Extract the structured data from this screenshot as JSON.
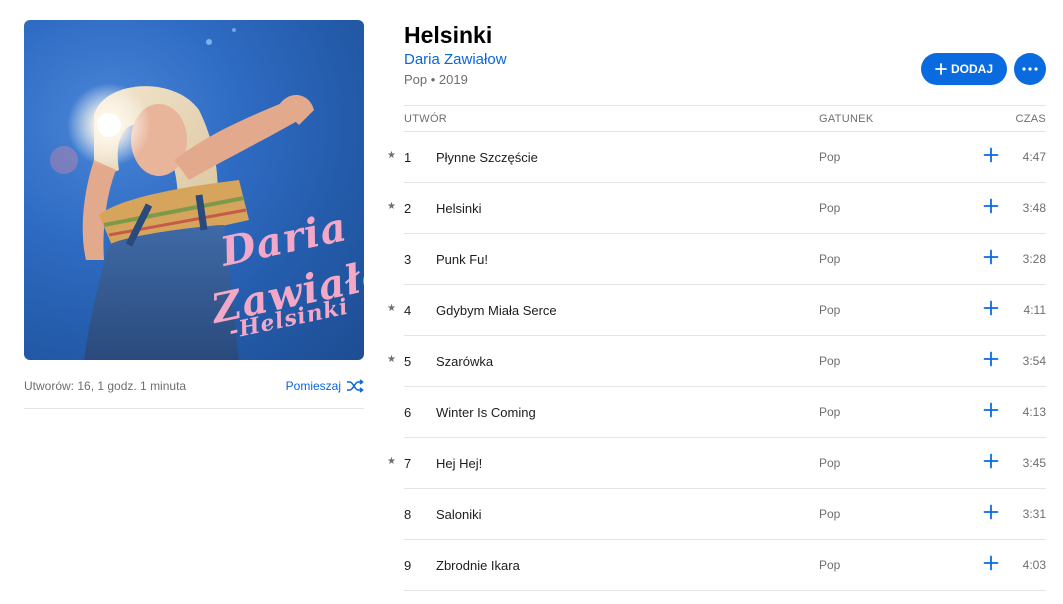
{
  "album": {
    "title": "Helsinki",
    "artist": "Daria Zawiałow",
    "genre_year": "Pop • 2019",
    "artwork_text": [
      "Daria",
      "Zawiałow",
      "-Helsinki"
    ]
  },
  "summary": {
    "track_count": "Utworów: 16, 1 godz. 1 minuta",
    "shuffle_label": "Pomieszaj"
  },
  "actions": {
    "add_label": "DODAJ",
    "add_icon": "plus-icon",
    "more_icon": "ellipsis-icon"
  },
  "columns": {
    "track": "UTWÓR",
    "genre": "GATUNEK",
    "time": "CZAS"
  },
  "tracks": [
    {
      "star": "★",
      "num": "1",
      "name": "Płynne Szczęście",
      "genre": "Pop",
      "time": "4:47"
    },
    {
      "star": "★",
      "num": "2",
      "name": "Helsinki",
      "genre": "Pop",
      "time": "3:48"
    },
    {
      "star": "",
      "num": "3",
      "name": "Punk Fu!",
      "genre": "Pop",
      "time": "3:28"
    },
    {
      "star": "★",
      "num": "4",
      "name": "Gdybym Miała Serce",
      "genre": "Pop",
      "time": "4:11"
    },
    {
      "star": "★",
      "num": "5",
      "name": "Szarówka",
      "genre": "Pop",
      "time": "3:54"
    },
    {
      "star": "",
      "num": "6",
      "name": "Winter Is Coming",
      "genre": "Pop",
      "time": "4:13"
    },
    {
      "star": "★",
      "num": "7",
      "name": "Hej Hej!",
      "genre": "Pop",
      "time": "3:45"
    },
    {
      "star": "",
      "num": "8",
      "name": "Saloniki",
      "genre": "Pop",
      "time": "3:31"
    },
    {
      "star": "",
      "num": "9",
      "name": "Zbrodnie Ikara",
      "genre": "Pop",
      "time": "4:03"
    }
  ],
  "colors": {
    "accent": "#0a6be0",
    "link": "#0a66d8",
    "secondary_text": "#6e6e73",
    "divider": "#e5e5e7"
  }
}
